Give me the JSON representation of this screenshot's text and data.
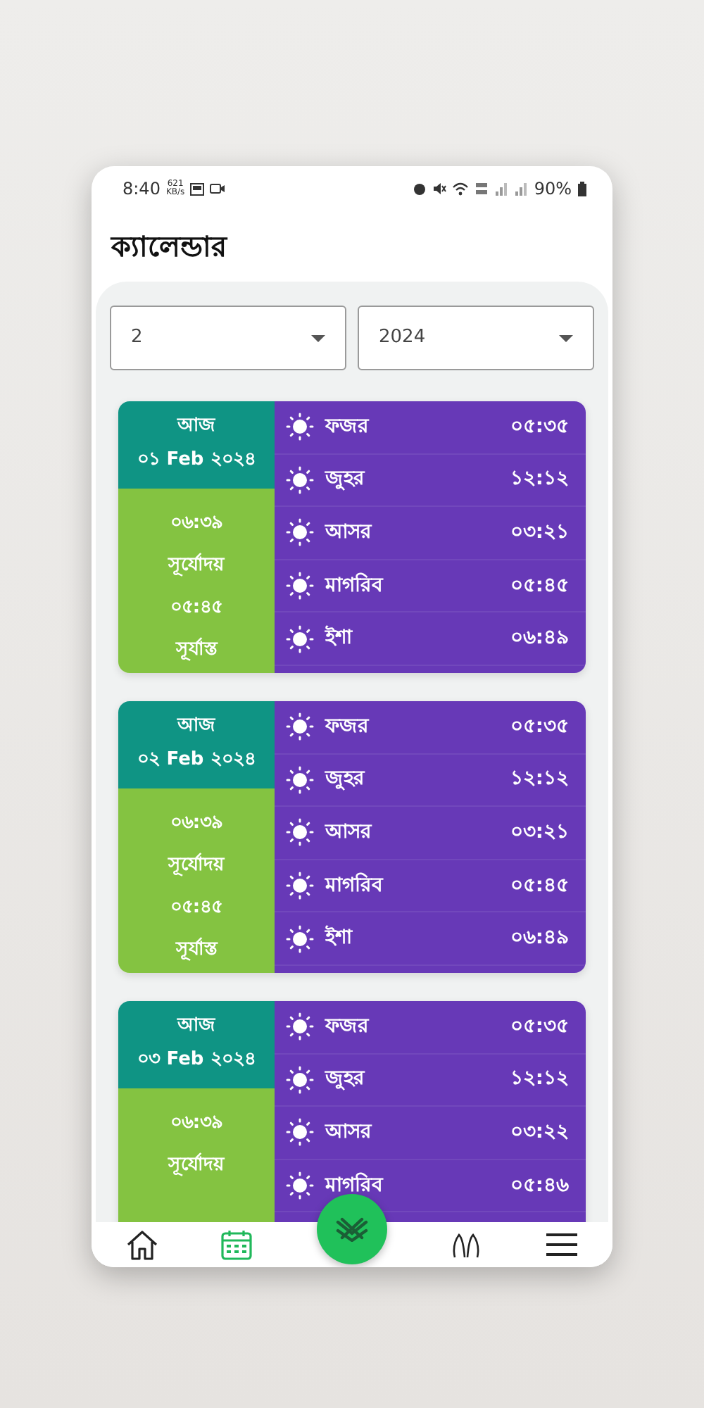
{
  "status_bar": {
    "time": "8:40",
    "net_speed": "621",
    "net_unit": "KB/s",
    "battery": "90%"
  },
  "title": "ক্যালেন্ডার",
  "filters": [
    {
      "value": "2"
    },
    {
      "value": "2024"
    }
  ],
  "days": [
    {
      "today_label": "আজ",
      "date": "০১ Feb ২০২৪",
      "sunrise": "০৬:৩৯",
      "sunrise_label": "সূর্যোদয়",
      "sunset": "০৫:৪৫",
      "sunset_label": "সূর্যাস্ত",
      "prayers": [
        {
          "name": "ফজর",
          "time": "০৫:৩৫"
        },
        {
          "name": "জুহর",
          "time": "১২:১২"
        },
        {
          "name": "আসর",
          "time": "০৩:২১"
        },
        {
          "name": "মাগরিব",
          "time": "০৫:৪৫"
        },
        {
          "name": "ইশা",
          "time": "০৬:৪৯"
        }
      ]
    },
    {
      "today_label": "আজ",
      "date": "০২ Feb ২০২৪",
      "sunrise": "০৬:৩৯",
      "sunrise_label": "সূর্যোদয়",
      "sunset": "০৫:৪৫",
      "sunset_label": "সূর্যাস্ত",
      "prayers": [
        {
          "name": "ফজর",
          "time": "০৫:৩৫"
        },
        {
          "name": "জুহর",
          "time": "১২:১২"
        },
        {
          "name": "আসর",
          "time": "০৩:২১"
        },
        {
          "name": "মাগরিব",
          "time": "০৫:৪৫"
        },
        {
          "name": "ইশা",
          "time": "০৬:৪৯"
        }
      ]
    },
    {
      "today_label": "আজ",
      "date": "০৩ Feb ২০২৪",
      "sunrise": "০৬:৩৯",
      "sunrise_label": "সূর্যোদয়",
      "prayers": [
        {
          "name": "ফজর",
          "time": "০৫:৩৫"
        },
        {
          "name": "জুহর",
          "time": "১২:১২"
        },
        {
          "name": "আসর",
          "time": "০৩:২২"
        },
        {
          "name": "মাগরিব",
          "time": "০৫:৪৬"
        }
      ]
    }
  ],
  "bottom_nav": [
    {
      "kind": "home",
      "selected": false
    },
    {
      "kind": "calendar",
      "selected": true
    },
    {
      "kind": "quran",
      "selected": false
    },
    {
      "kind": "dua",
      "selected": false
    },
    {
      "kind": "menu",
      "selected": false
    }
  ]
}
